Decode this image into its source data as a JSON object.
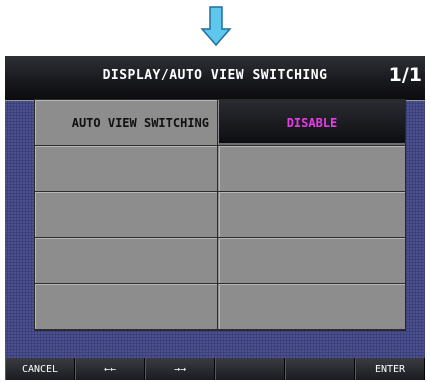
{
  "screen": {
    "title": "DISPLAY/AUTO VIEW SWITCHING",
    "page_indicator": "1/1"
  },
  "settings_table": {
    "rows": [
      {
        "label": "AUTO VIEW SWITCHING",
        "value": "DISABLE"
      },
      {
        "label": "",
        "value": ""
      },
      {
        "label": "",
        "value": ""
      },
      {
        "label": "",
        "value": ""
      },
      {
        "label": "",
        "value": ""
      }
    ]
  },
  "softkeys": [
    {
      "label": "CANCEL"
    },
    {
      "label": "←←"
    },
    {
      "label": "→→"
    },
    {
      "label": ""
    },
    {
      "label": ""
    },
    {
      "label": "ENTER"
    }
  ],
  "colors": {
    "screen_background": "#3b3f7e",
    "cell_gray": "#8d8d8d",
    "selected_value_text": "#e83ce8",
    "indicator_arrow": "#5fc6ec"
  },
  "icons": {
    "indicator": "down-arrow-icon"
  }
}
